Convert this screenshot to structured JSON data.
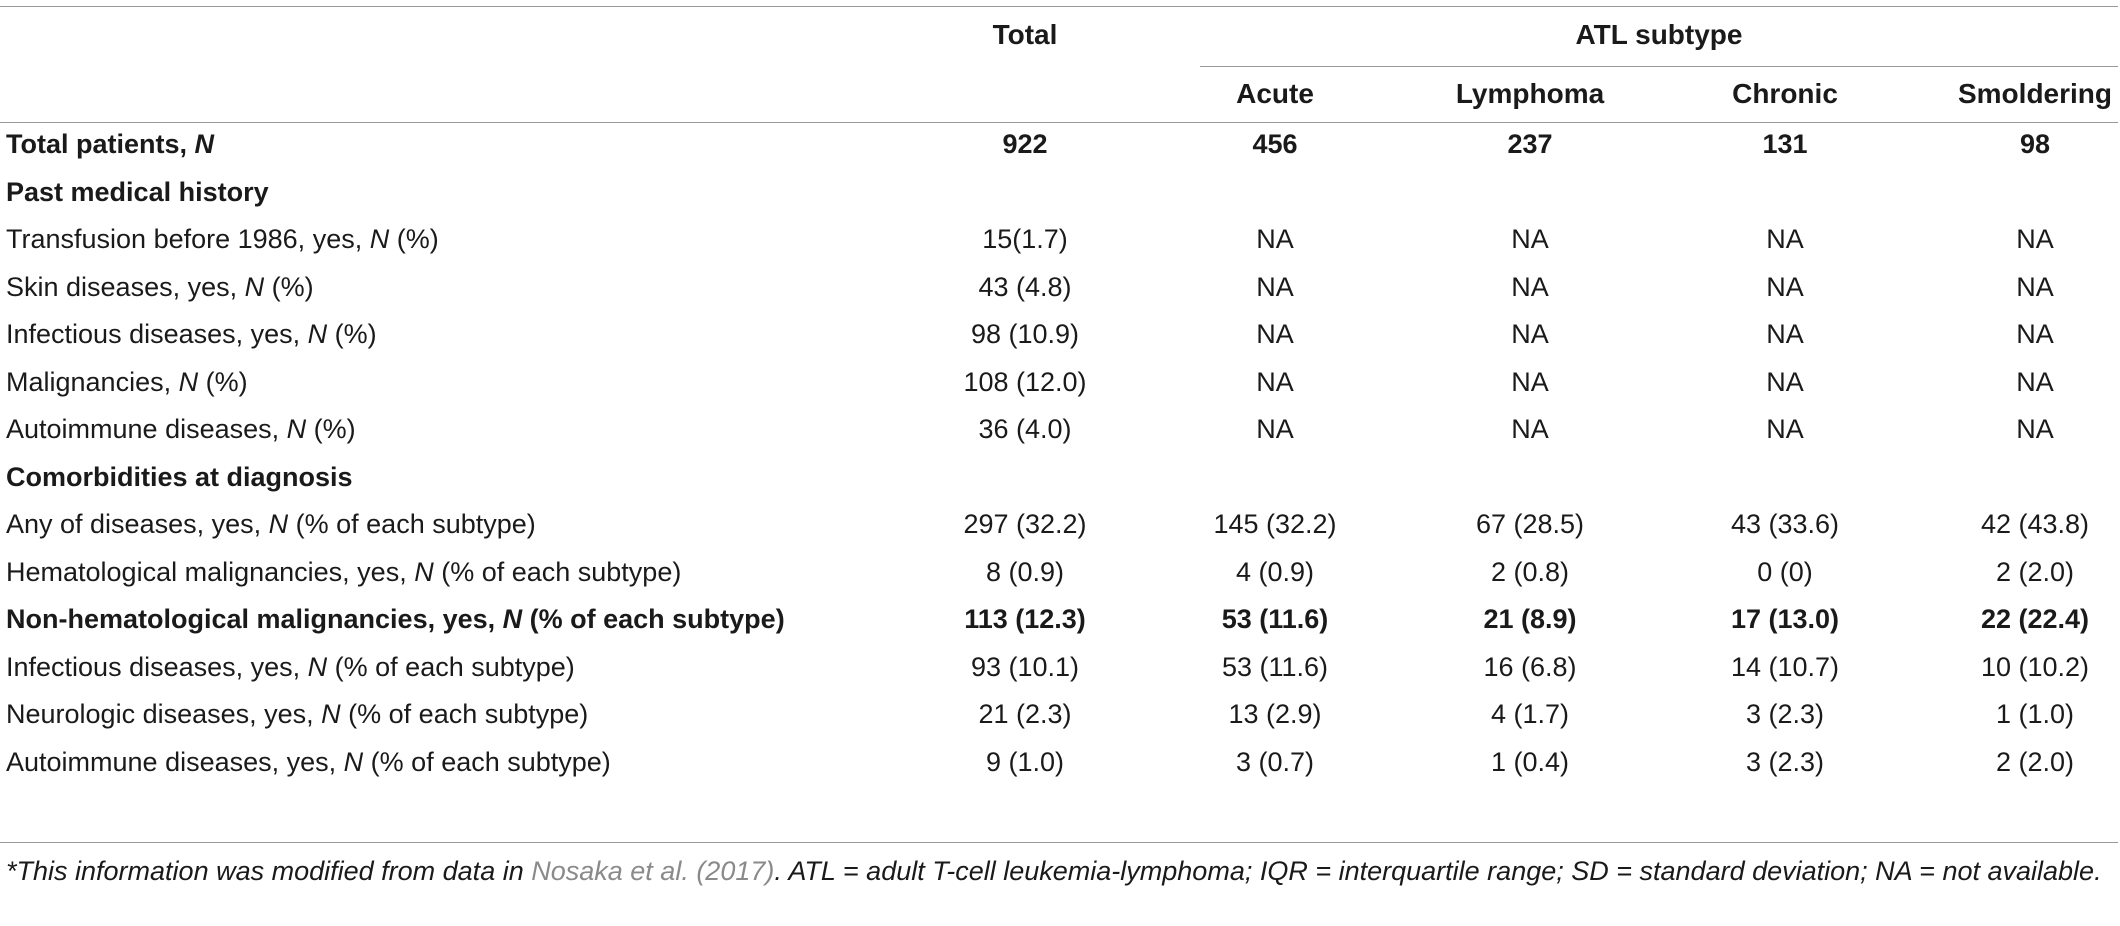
{
  "table": {
    "header": {
      "total": "Total",
      "group": "ATL subtype",
      "subtypes": [
        "Acute",
        "Lymphoma",
        "Chronic",
        "Smoldering"
      ]
    },
    "rows": [
      {
        "label": "Total patients, N",
        "label_pre": "Total patients, ",
        "label_em": "N",
        "label_post": "",
        "bold": true,
        "section": false,
        "values": [
          "922",
          "456",
          "237",
          "131",
          "98"
        ]
      },
      {
        "label": "Past medical history",
        "label_pre": "Past medical history",
        "label_em": "",
        "label_post": "",
        "bold": true,
        "section": true,
        "values": [
          "",
          "",
          "",
          "",
          ""
        ]
      },
      {
        "label": "Transfusion before 1986, yes, N (%)",
        "label_pre": "Transfusion before 1986, yes, ",
        "label_em": "N",
        "label_post": " (%)",
        "bold": false,
        "section": false,
        "values": [
          "15(1.7)",
          "NA",
          "NA",
          "NA",
          "NA"
        ]
      },
      {
        "label": "Skin diseases, yes, N (%)",
        "label_pre": "Skin diseases, yes, ",
        "label_em": "N",
        "label_post": " (%)",
        "bold": false,
        "section": false,
        "values": [
          "43 (4.8)",
          "NA",
          "NA",
          "NA",
          "NA"
        ]
      },
      {
        "label": "Infectious diseases, yes, N (%)",
        "label_pre": "Infectious diseases, yes, ",
        "label_em": "N",
        "label_post": " (%)",
        "bold": false,
        "section": false,
        "values": [
          "98 (10.9)",
          "NA",
          "NA",
          "NA",
          "NA"
        ]
      },
      {
        "label": "Malignancies, N (%)",
        "label_pre": "Malignancies, ",
        "label_em": "N",
        "label_post": " (%)",
        "bold": false,
        "section": false,
        "values": [
          "108 (12.0)",
          "NA",
          "NA",
          "NA",
          "NA"
        ]
      },
      {
        "label": "Autoimmune diseases, N (%)",
        "label_pre": "Autoimmune diseases, ",
        "label_em": "N",
        "label_post": " (%)",
        "bold": false,
        "section": false,
        "values": [
          "36 (4.0)",
          "NA",
          "NA",
          "NA",
          "NA"
        ]
      },
      {
        "label": "Comorbidities at diagnosis",
        "label_pre": "Comorbidities at diagnosis",
        "label_em": "",
        "label_post": "",
        "bold": true,
        "section": true,
        "values": [
          "",
          "",
          "",
          "",
          ""
        ]
      },
      {
        "label": "Any of diseases, yes, N (% of each subtype)",
        "label_pre": "Any of diseases, yes, ",
        "label_em": "N",
        "label_post": " (% of each subtype)",
        "bold": false,
        "section": false,
        "values": [
          "297 (32.2)",
          "145 (32.2)",
          "67 (28.5)",
          "43 (33.6)",
          "42 (43.8)"
        ]
      },
      {
        "label": "Hematological malignancies, yes, N (% of each subtype)",
        "label_pre": "Hematological malignancies, yes, ",
        "label_em": "N",
        "label_post": " (% of each subtype)",
        "bold": false,
        "section": false,
        "values": [
          "8 (0.9)",
          "4 (0.9)",
          "2 (0.8)",
          "0 (0)",
          "2 (2.0)"
        ]
      },
      {
        "label": "Non-hematological malignancies, yes, N (% of each subtype)",
        "label_pre": "Non-hematological malignancies, yes, ",
        "label_em": "N",
        "label_post": " (% of each subtype)",
        "bold": true,
        "section": false,
        "values": [
          "113 (12.3)",
          "53 (11.6)",
          "21 (8.9)",
          "17 (13.0)",
          "22 (22.4)"
        ]
      },
      {
        "label": "Infectious diseases, yes, N (% of each subtype)",
        "label_pre": "Infectious diseases, yes, ",
        "label_em": "N",
        "label_post": " (% of each subtype)",
        "bold": false,
        "section": false,
        "values": [
          "93 (10.1)",
          "53 (11.6)",
          "16 (6.8)",
          "14 (10.7)",
          "10 (10.2)"
        ]
      },
      {
        "label": "Neurologic diseases, yes, N (% of each subtype)",
        "label_pre": "Neurologic diseases, yes, ",
        "label_em": "N",
        "label_post": " (% of each subtype)",
        "bold": false,
        "section": false,
        "values": [
          "21 (2.3)",
          "13 (2.9)",
          "4 (1.7)",
          "3 (2.3)",
          "1 (1.0)"
        ]
      },
      {
        "label": "Autoimmune diseases, yes, N (% of each subtype)",
        "label_pre": "Autoimmune diseases, yes, ",
        "label_em": "N",
        "label_post": " (% of each subtype)",
        "bold": false,
        "section": false,
        "values": [
          "9 (1.0)",
          "3 (0.7)",
          "1 (0.4)",
          "3 (2.3)",
          "2 (2.0)"
        ]
      }
    ]
  },
  "footnote": {
    "before_cite": "*This information was modified from data in ",
    "cite": "Nosaka et al. (2017)",
    "after_cite": ". ATL = adult T-cell leukemia-lymphoma; IQR = interquartile range; SD = standard deviation; NA = not available."
  },
  "colors": {
    "text": "#1a1a1a",
    "rule": "#9a9a9a",
    "citation_link": "#8a8a8a"
  }
}
